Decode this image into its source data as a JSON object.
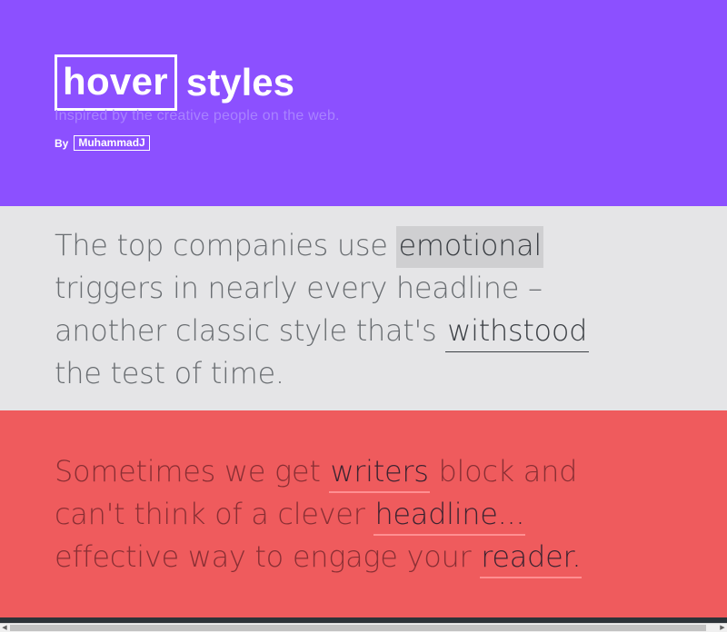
{
  "header": {
    "brand_boxed": "hover",
    "brand_rest": "styles",
    "tagline": "Inspired by the creative people on the web.",
    "by_label": "By",
    "author": "MuhammadJ"
  },
  "section_grey": {
    "t1": "The top companies use ",
    "h1": "emotional",
    "t2": " triggers in nearly every headline – another classic style that's ",
    "h2": "withstood",
    "t3": " the test of time."
  },
  "section_red": {
    "t1": "Sometimes we get ",
    "h1": "writers",
    "t2": " block and can't think of a clever ",
    "h2": "headline...",
    "t3": " effective way to engage your ",
    "h3": "reader."
  },
  "colors": {
    "purple": "#8c50ff",
    "grey": "#e5e5e7",
    "red": "#ef5b5d",
    "dark": "#2c3338"
  },
  "icons": {
    "scroll_left": "chevron-left-icon",
    "scroll_right": "chevron-right-icon"
  }
}
